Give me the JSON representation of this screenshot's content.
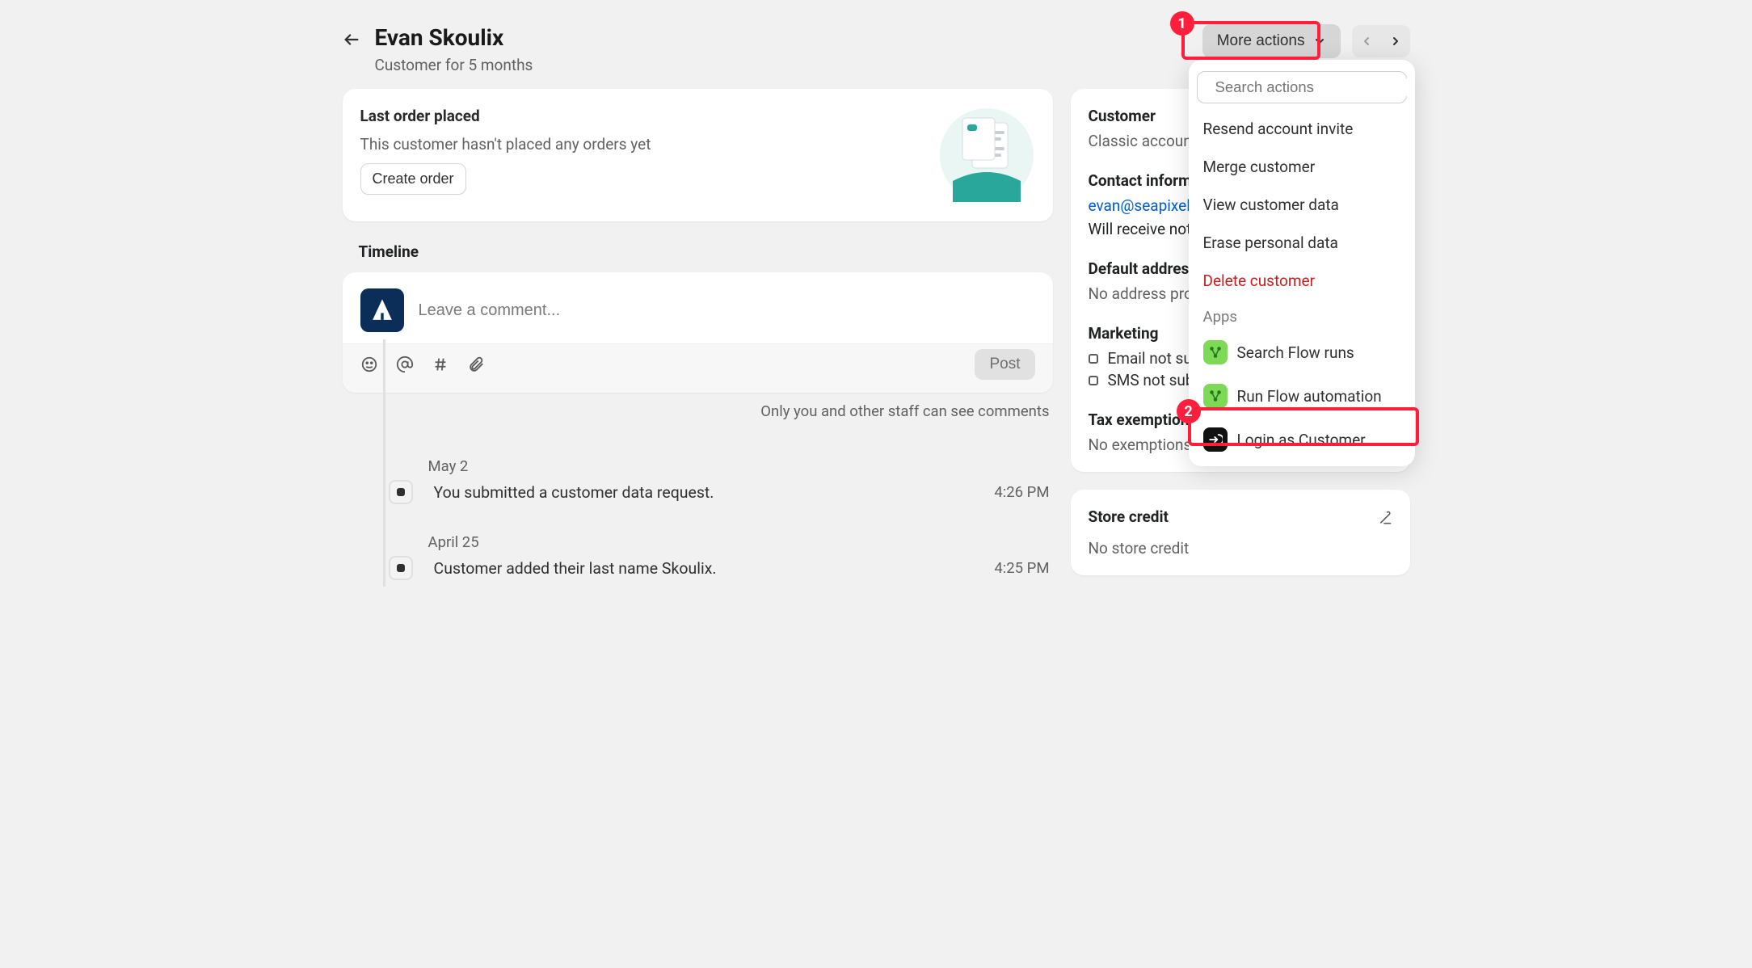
{
  "header": {
    "customer_name": "Evan Skoulix",
    "subtitle": "Customer for 5 months",
    "more_actions_label": "More actions"
  },
  "order_card": {
    "title": "Last order placed",
    "body": "This customer hasn't placed any orders yet",
    "button": "Create order"
  },
  "timeline": {
    "heading": "Timeline",
    "comment_placeholder": "Leave a comment...",
    "post_label": "Post",
    "visibility_note": "Only you and other staff can see comments",
    "groups": [
      {
        "date": "May 2",
        "items": [
          {
            "text": "You submitted a customer data request.",
            "time": "4:26 PM"
          }
        ]
      },
      {
        "date": "April 25",
        "items": [
          {
            "text": "Customer added their last name Skoulix.",
            "time": "4:25 PM"
          }
        ]
      }
    ]
  },
  "customer_panel": {
    "customer_heading": "Customer",
    "account_invite_label": "Classic account inv",
    "contact_heading": "Contact information",
    "email": "evan@seapixel.com",
    "notif_line": "Will receive notific",
    "address_heading": "Default address",
    "address_body": "No address provide",
    "marketing_heading": "Marketing",
    "marketing_email": "Email not subs",
    "marketing_sms": "SMS not subscri",
    "tax_heading": "Tax exemptions",
    "tax_body": "No exemptions"
  },
  "store_credit": {
    "heading": "Store credit",
    "body": "No store credit"
  },
  "dropdown": {
    "search_placeholder": "Search actions",
    "items": [
      {
        "label": "Resend account invite",
        "type": "normal"
      },
      {
        "label": "Merge customer",
        "type": "normal"
      },
      {
        "label": "View customer data",
        "type": "normal"
      },
      {
        "label": "Erase personal data",
        "type": "normal"
      },
      {
        "label": "Delete customer",
        "type": "danger"
      }
    ],
    "apps_label": "Apps",
    "app_items": [
      {
        "label": "Search Flow runs",
        "icon": "green"
      },
      {
        "label": "Run Flow automation",
        "icon": "green"
      },
      {
        "label": "Login as Customer",
        "icon": "black"
      }
    ]
  },
  "annotations": {
    "badge1": "1",
    "badge2": "2"
  }
}
